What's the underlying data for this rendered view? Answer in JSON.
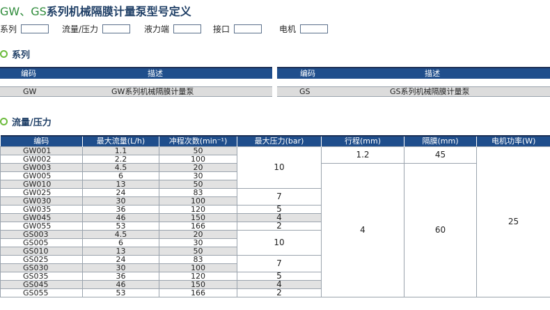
{
  "title": {
    "prefix": "GW、GS",
    "rest": "系列机械隔膜计量泵型号定义"
  },
  "fields": [
    {
      "label": "系列"
    },
    {
      "label": "流量/压力"
    },
    {
      "label": "液力端"
    },
    {
      "label": "接口"
    },
    {
      "label": "电机"
    }
  ],
  "sections": {
    "series": "系列",
    "flow": "流量/压力"
  },
  "series_table": {
    "headers": {
      "code": "编码",
      "desc": "描述"
    },
    "left": {
      "code": "GW",
      "desc": "GW系列机械隔膜计量泵"
    },
    "right": {
      "code": "GS",
      "desc": "GS系列机械隔膜计量泵"
    }
  },
  "flow_table": {
    "headers": [
      "编码",
      "最大流量(L/h)",
      "冲程次数(min⁻¹)",
      "最大压力(bar)",
      "行程(mm)",
      "隔膜(mm)",
      "电机功率(W)"
    ],
    "rows": [
      {
        "code": "GW001",
        "flow": "1.1",
        "spm": "50"
      },
      {
        "code": "GW002",
        "flow": "2.2",
        "spm": "100"
      },
      {
        "code": "GW003",
        "flow": "4.5",
        "spm": "20"
      },
      {
        "code": "GW005",
        "flow": "6",
        "spm": "30"
      },
      {
        "code": "GW010",
        "flow": "13",
        "spm": "50"
      },
      {
        "code": "GW025",
        "flow": "24",
        "spm": "83"
      },
      {
        "code": "GW030",
        "flow": "30",
        "spm": "100"
      },
      {
        "code": "GW035",
        "flow": "36",
        "spm": "120"
      },
      {
        "code": "GW045",
        "flow": "46",
        "spm": "150"
      },
      {
        "code": "GW055",
        "flow": "53",
        "spm": "166"
      },
      {
        "code": "GS003",
        "flow": "4.5",
        "spm": "20"
      },
      {
        "code": "GS005",
        "flow": "6",
        "spm": "30"
      },
      {
        "code": "GS010",
        "flow": "13",
        "spm": "50"
      },
      {
        "code": "GS025",
        "flow": "24",
        "spm": "83"
      },
      {
        "code": "GS030",
        "flow": "30",
        "spm": "100"
      },
      {
        "code": "GS035",
        "flow": "36",
        "spm": "120"
      },
      {
        "code": "GS045",
        "flow": "46",
        "spm": "150"
      },
      {
        "code": "GS055",
        "flow": "53",
        "spm": "166"
      }
    ],
    "pressure": [
      "10",
      "7",
      "5",
      "4",
      "2",
      "10",
      "7",
      "5",
      "4",
      "2"
    ],
    "stroke": [
      "1.2",
      "4"
    ],
    "diaphragm": [
      "45",
      "60"
    ],
    "motor": "25"
  }
}
